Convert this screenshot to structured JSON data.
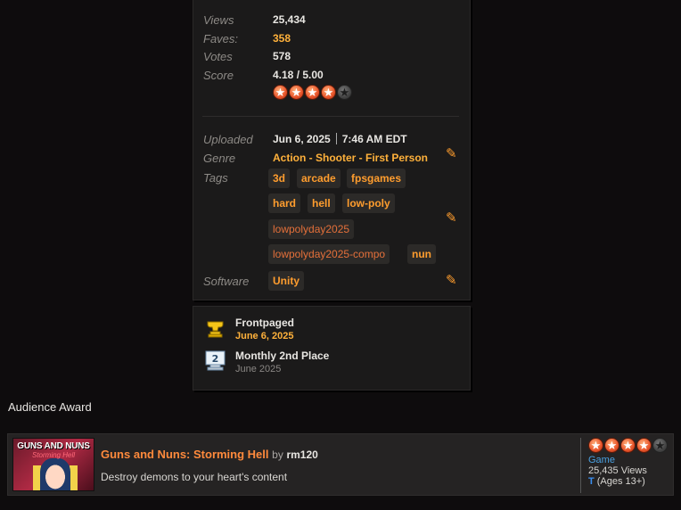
{
  "stats": {
    "views_label": "Views",
    "views": "25,434",
    "faves_label": "Faves:",
    "faves": "358",
    "votes_label": "Votes",
    "votes": "578",
    "score_label": "Score",
    "score": "4.18 / 5.00",
    "score_value": 4.18,
    "star_count": 5
  },
  "info": {
    "uploaded_label": "Uploaded",
    "upload_date": "Jun 6, 2025",
    "upload_time": "7:46 AM EDT",
    "genre_label": "Genre",
    "genre": "Action - Shooter - First Person",
    "tags_label": "Tags",
    "tags": [
      "3d",
      "arcade",
      "fpsgames",
      "hard",
      "hell",
      "low-poly",
      "lowpolyday2025",
      "lowpolyday2025-compo",
      "nun"
    ],
    "software_label": "Software",
    "software": [
      "Unity"
    ]
  },
  "awards": [
    {
      "title": "Frontpaged",
      "date": "June 6, 2025",
      "icon": "trophy-icon"
    },
    {
      "title": "Monthly 2nd Place",
      "date": "June 2025",
      "icon": "second-place-icon"
    }
  ],
  "audience_award": {
    "section_title": "Audience Award",
    "thumb_title": "GUNS AND NUNS",
    "thumb_subtitle": "Storming Hell",
    "title": "Guns and Nuns: Storming Hell",
    "by": "by",
    "author": "rm120",
    "description": "Destroy demons to your heart's content",
    "rating_stars": 4,
    "type": "Game",
    "views": "25,435 Views",
    "age_rating_letter": "T",
    "age_rating": "(Ages 13+)"
  },
  "colors": {
    "accent_orange": "#ffb13b",
    "tag_text": "#ff9d2e",
    "link_blue": "#4aa0e0",
    "panel_bg": "#1b1a1a",
    "page_bg": "#0e0c0d"
  }
}
